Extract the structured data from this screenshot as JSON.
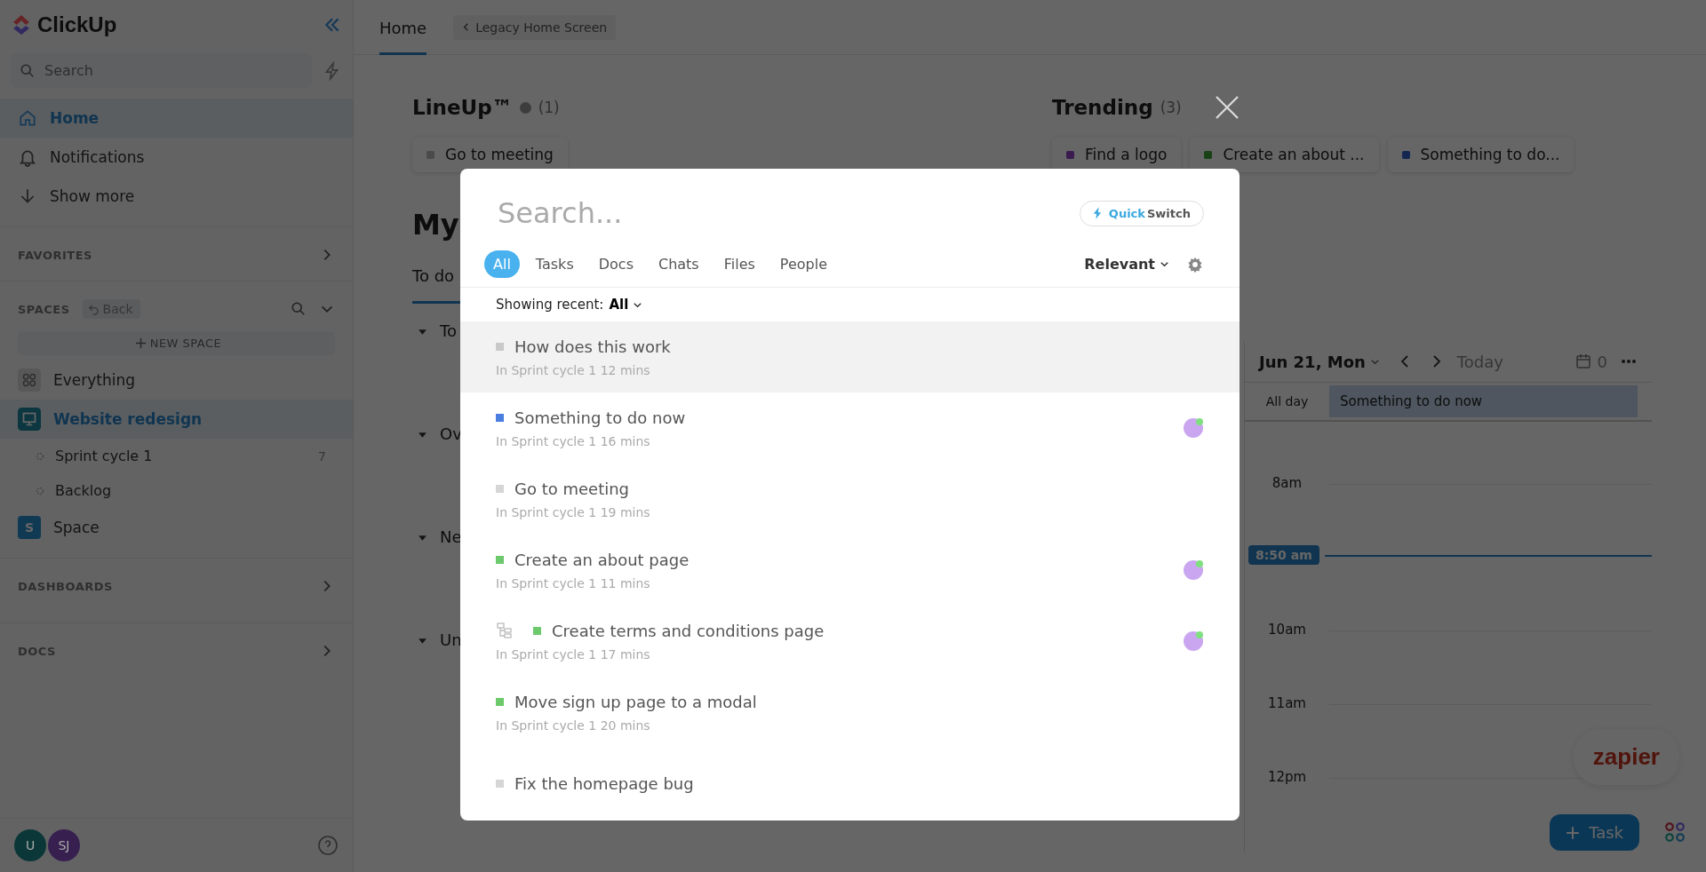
{
  "sidebar": {
    "logo": "ClickUp",
    "search": {
      "placeholder": "Search"
    },
    "nav": [
      {
        "label": "Home",
        "selected": true
      },
      {
        "label": "Notifications",
        "selected": false
      },
      {
        "label": "Show more",
        "selected": false
      }
    ],
    "favorites": "FAVORITES",
    "spaces_label": "SPACES",
    "back": "Back",
    "new_space": "NEW SPACE",
    "spaces": [
      {
        "kind": "everything",
        "label": "Everything",
        "selected": false
      },
      {
        "kind": "space",
        "label": "Website redesign",
        "selected": true,
        "children": [
          {
            "label": "Sprint cycle 1",
            "count": "7"
          },
          {
            "label": "Backlog"
          }
        ]
      },
      {
        "kind": "letter",
        "badge": "S",
        "label": "Space",
        "selected": false
      }
    ],
    "dashboards": "DASHBOARDS",
    "docs": "DOCS",
    "avatars": [
      {
        "initials": "U",
        "color": "#0c3739"
      },
      {
        "initials": "SJ",
        "color": "#372050"
      }
    ]
  },
  "topbar": {
    "tabs": [
      {
        "label": "Home",
        "selected": true
      }
    ],
    "legacy": "Legacy Home Screen"
  },
  "lineup": {
    "title": "LineUp™",
    "count": "(1)",
    "cards": [
      {
        "title": "Go to meeting",
        "color": "#4a4a4a"
      }
    ]
  },
  "trending": {
    "title": "Trending",
    "count": "(3)",
    "cards": [
      {
        "title": "Find a logo",
        "color": "#391b50"
      },
      {
        "title": "Create an about ...",
        "color": "#194317"
      },
      {
        "title": "Something to do...",
        "color": "#152650"
      }
    ]
  },
  "my_work": {
    "heading": "My",
    "tab": "To do",
    "sections": [
      "To",
      "Ov",
      "Ne",
      "Un"
    ]
  },
  "calendar": {
    "date": "Jun 21, Mon",
    "today": "Today",
    "count": "0",
    "all_day": "All day",
    "event": "Something to do now",
    "hours": [
      "8am",
      "10am",
      "11am",
      "12pm"
    ],
    "now": "8:50 am"
  },
  "zapier": "zapier",
  "fab": "Task",
  "modal": {
    "placeholder": "Search...",
    "quick": "Quick",
    "switch": "Switch",
    "filters": [
      {
        "label": "All",
        "selected": true
      },
      {
        "label": "Tasks",
        "selected": false
      },
      {
        "label": "Docs",
        "selected": false
      },
      {
        "label": "Chats",
        "selected": false
      },
      {
        "label": "Files",
        "selected": false
      },
      {
        "label": "People",
        "selected": false
      }
    ],
    "sort": "Relevant",
    "recent_label": "Showing recent:",
    "recent_value": "All",
    "results": [
      {
        "title": "How does this work",
        "color": "#c9c9c9",
        "meta": "In Sprint cycle 1 12 mins",
        "selected": true,
        "assignee": false,
        "subtask": false
      },
      {
        "title": "Something to do now",
        "color": "#4a7fe0",
        "meta": "In Sprint cycle 1 16 mins",
        "selected": false,
        "assignee": true,
        "subtask": false
      },
      {
        "title": "Go to meeting",
        "color": "#d6d6d6",
        "meta": "In Sprint cycle 1 19 mins",
        "selected": false,
        "assignee": false,
        "subtask": false
      },
      {
        "title": "Create an about page",
        "color": "#6cc96c",
        "meta": "In Sprint cycle 1 11 mins",
        "selected": false,
        "assignee": true,
        "subtask": false
      },
      {
        "title": "Create terms and conditions page",
        "color": "#6cc96c",
        "meta": "In Sprint cycle 1 17 mins",
        "selected": false,
        "assignee": true,
        "subtask": true
      },
      {
        "title": "Move sign up page to a modal",
        "color": "#6cc96c",
        "meta": "In Sprint cycle 1 20 mins",
        "selected": false,
        "assignee": false,
        "subtask": false
      },
      {
        "title": "Fix the homepage bug",
        "color": "#d6d6d6",
        "selected": false,
        "assignee": false,
        "subtask": false
      }
    ]
  }
}
